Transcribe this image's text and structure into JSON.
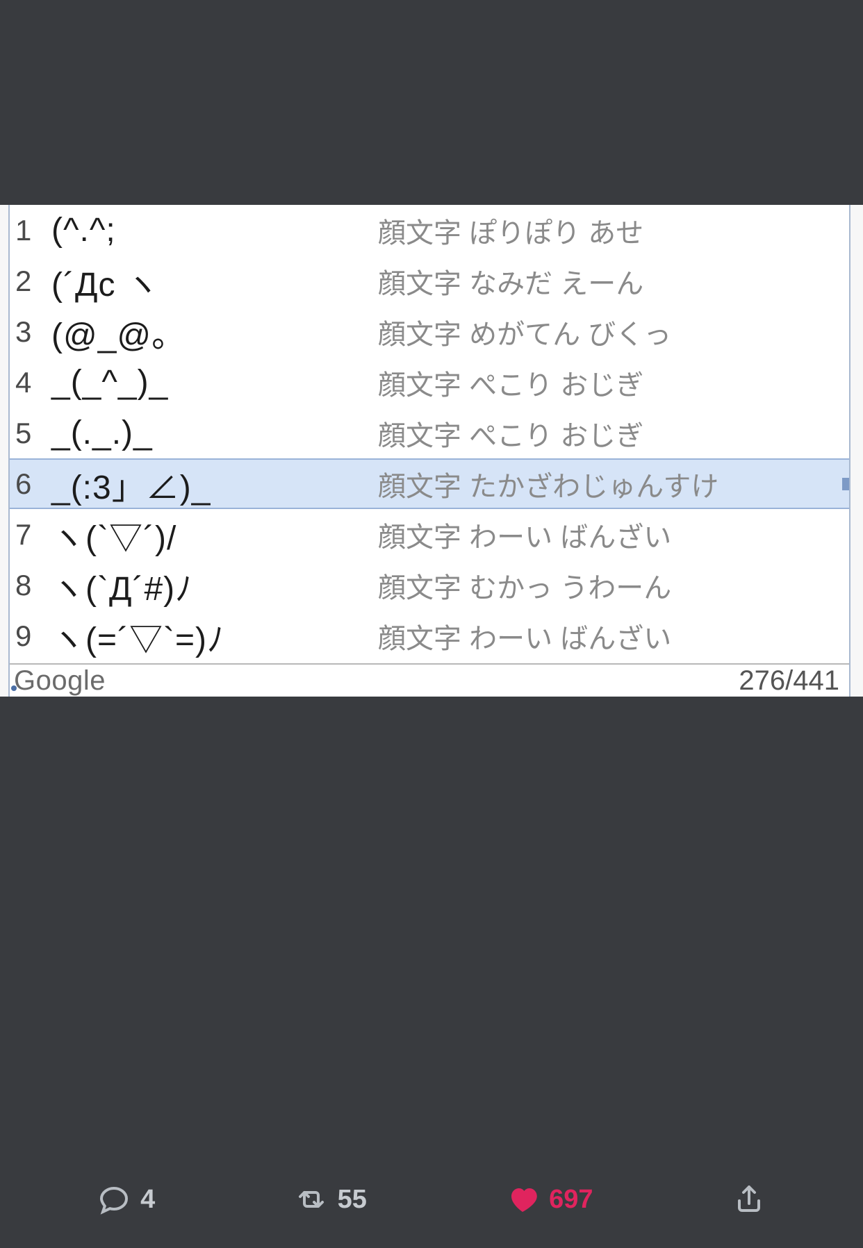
{
  "ime": {
    "provider": "Google",
    "counter": "276/441",
    "selected_index": 5,
    "items": [
      {
        "num": "1",
        "candidate": "(^.^;",
        "desc": "顔文字 ぽりぽり あせ"
      },
      {
        "num": "2",
        "candidate": "(´Дc ヽ",
        "desc": "顔文字 なみだ えーん"
      },
      {
        "num": "3",
        "candidate": "(@_@。",
        "desc": "顔文字 めがてん びくっ"
      },
      {
        "num": "4",
        "candidate": "_(_^_)_",
        "desc": "顔文字 ぺこり おじぎ"
      },
      {
        "num": "5",
        "candidate": "_(._.)_",
        "desc": "顔文字 ぺこり おじぎ"
      },
      {
        "num": "6",
        "candidate": "_(:3」∠)_",
        "desc": "顔文字 たかざわじゅんすけ"
      },
      {
        "num": "7",
        "candidate": "ヽ(`▽´)/",
        "desc": "顔文字 わーい ばんざい"
      },
      {
        "num": "8",
        "candidate": "ヽ(`Д´#)ﾉ",
        "desc": "顔文字 むかっ うわーん"
      },
      {
        "num": "9",
        "candidate": "ヽ(=´▽`=)ﾉ",
        "desc": "顔文字 わーい ばんざい"
      }
    ]
  },
  "tweet_actions": {
    "replies": "4",
    "retweets": "55",
    "likes": "697",
    "liked": true
  }
}
